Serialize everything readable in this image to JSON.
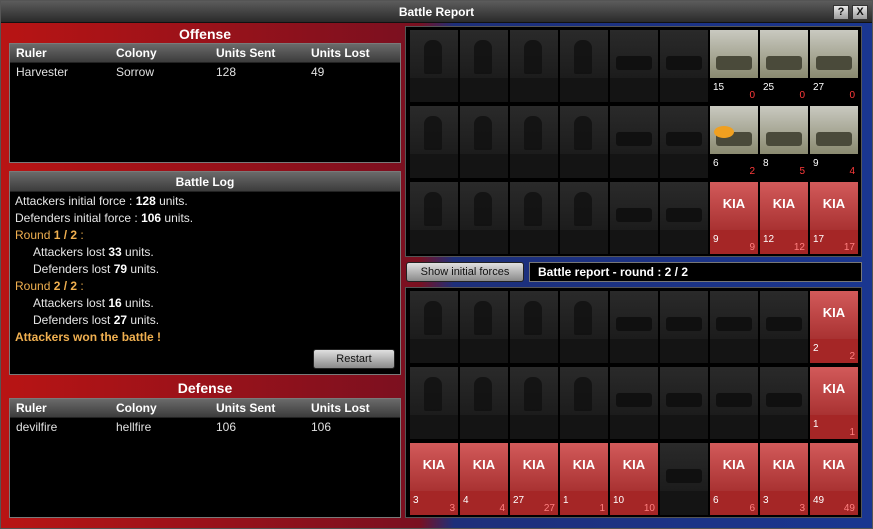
{
  "window": {
    "title": "Battle Report",
    "help_label": "?",
    "close_label": "X"
  },
  "offense": {
    "heading": "Offense",
    "columns": [
      "Ruler",
      "Colony",
      "Units Sent",
      "Units Lost"
    ],
    "rows": [
      [
        "Harvester",
        "Sorrow",
        "128",
        "49"
      ]
    ]
  },
  "log": {
    "heading": "Battle Log",
    "lines": {
      "att_init_pre": "Attackers initial force : ",
      "att_init_val": "128",
      "att_init_post": " units.",
      "def_init_pre": "Defenders initial force : ",
      "def_init_val": "106",
      "def_init_post": " units.",
      "r1_pre": "Round ",
      "r1_val": "1 / 2",
      "r1_post": " :",
      "r1_att_pre": "Attackers lost ",
      "r1_att_val": "33",
      "r1_att_post": " units.",
      "r1_def_pre": "Defenders lost ",
      "r1_def_val": "79",
      "r1_def_post": " units.",
      "r2_pre": "Round ",
      "r2_val": "2 / 2",
      "r2_post": " :",
      "r2_att_pre": "Attackers lost ",
      "r2_att_val": "16",
      "r2_att_post": " units.",
      "r2_def_pre": "Defenders lost ",
      "r2_def_val": "27",
      "r2_def_post": " units.",
      "result": "Attackers won the battle !"
    },
    "restart_label": "Restart"
  },
  "defense": {
    "heading": "Defense",
    "columns": [
      "Ruler",
      "Colony",
      "Units Sent",
      "Units Lost"
    ],
    "rows": [
      [
        "devilfire",
        "hellfire",
        "106",
        "106"
      ]
    ]
  },
  "controls": {
    "show_initial_label": "Show initial forces",
    "round_status": "Battle report - round : 2 / 2"
  },
  "kia_label": "KIA",
  "attacker_units": [
    [
      null,
      null,
      null,
      null,
      null,
      null,
      {
        "state": "live",
        "count": "15",
        "lost": "0"
      },
      {
        "state": "live",
        "count": "25",
        "lost": "0"
      },
      {
        "state": "live",
        "count": "27",
        "lost": "0"
      }
    ],
    [
      null,
      null,
      null,
      null,
      null,
      null,
      {
        "state": "live",
        "count": "6",
        "lost": "2"
      },
      {
        "state": "live",
        "count": "8",
        "lost": "5"
      },
      {
        "state": "live",
        "count": "9",
        "lost": "4"
      }
    ],
    [
      null,
      null,
      null,
      null,
      null,
      null,
      {
        "state": "kia",
        "count": "9",
        "lost": "9"
      },
      {
        "state": "kia",
        "count": "12",
        "lost": "12"
      },
      {
        "state": "kia",
        "count": "17",
        "lost": "17"
      }
    ]
  ],
  "defender_units": [
    [
      null,
      null,
      null,
      null,
      null,
      null,
      null,
      null,
      {
        "state": "kia",
        "count": "2",
        "lost": "2"
      }
    ],
    [
      null,
      null,
      null,
      null,
      null,
      null,
      null,
      null,
      {
        "state": "kia",
        "count": "1",
        "lost": "1"
      }
    ],
    [
      {
        "state": "kia",
        "count": "3",
        "lost": "3"
      },
      {
        "state": "kia",
        "count": "4",
        "lost": "4"
      },
      {
        "state": "kia",
        "count": "27",
        "lost": "27"
      },
      {
        "state": "kia",
        "count": "1",
        "lost": "1"
      },
      {
        "state": "kia",
        "count": "10",
        "lost": "10"
      },
      null,
      {
        "state": "kia",
        "count": "6",
        "lost": "6"
      },
      {
        "state": "kia",
        "count": "3",
        "lost": "3"
      },
      {
        "state": "kia",
        "count": "49",
        "lost": "49"
      }
    ]
  ]
}
